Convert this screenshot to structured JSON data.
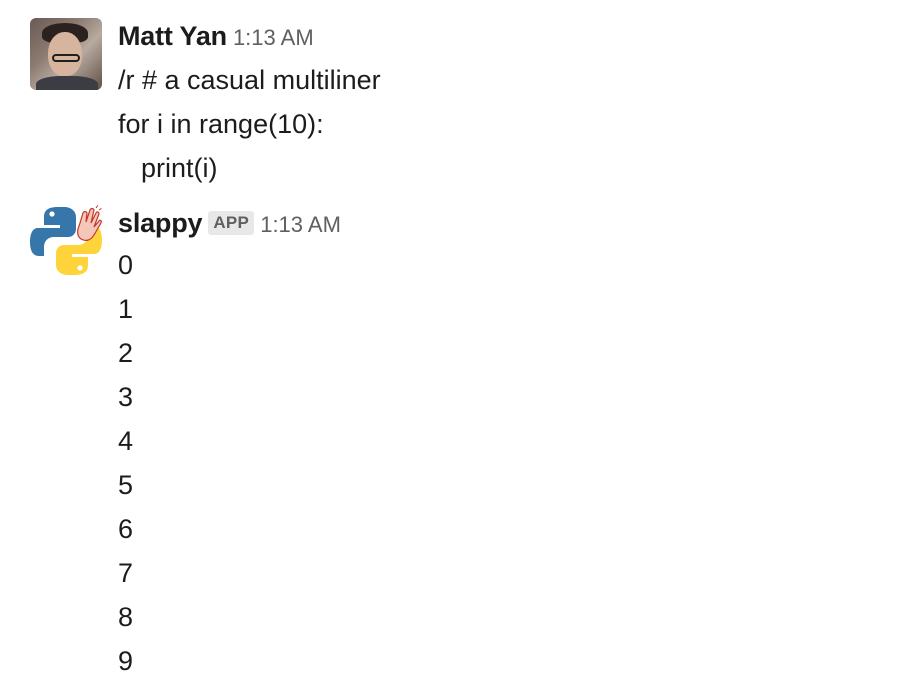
{
  "messages": [
    {
      "sender": "Matt Yan",
      "timestamp": "1:13 AM",
      "avatar_icon": "user-photo-avatar",
      "lines": [
        "/r # a casual multiliner",
        "for i in range(10):",
        "print(i)"
      ]
    },
    {
      "sender": "slappy",
      "badge": "APP",
      "timestamp": "1:13 AM",
      "avatar_icon": "python-logo-waving-hand-icon",
      "lines": [
        "0",
        "1",
        "2",
        "3",
        "4",
        "5",
        "6",
        "7",
        "8",
        "9"
      ]
    }
  ],
  "colors": {
    "text": "#1d1c1d",
    "timestamp": "#616061",
    "badge_bg": "#e8e8e8",
    "python_blue": "#3776ab",
    "python_yellow": "#ffd43b"
  }
}
